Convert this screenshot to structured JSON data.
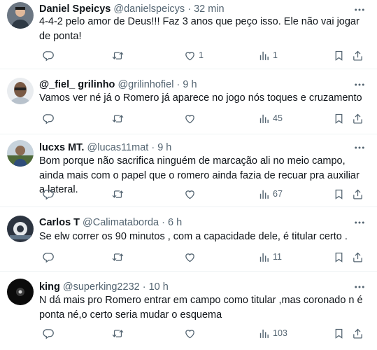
{
  "tweets": [
    {
      "name": "Daniel Speicys",
      "handle": "@danielspeicys",
      "separator": "·",
      "time": "32 min",
      "text": "4-4-2 pelo amor de Deus!!! Faz 3 anos que peço isso. Ele não vai jogar de ponta!",
      "replies": "",
      "retweets": "",
      "likes": "1",
      "views": "1"
    },
    {
      "name": "@_fiel_ grilinho",
      "handle": "@grilinhofiel",
      "separator": "·",
      "time": "9 h",
      "text": "Vamos ver né já o Romero já aparece no jogo nós toques e cruzamento",
      "replies": "",
      "retweets": "",
      "likes": "",
      "views": "45"
    },
    {
      "name": "lucxs MT.",
      "handle": "@lucas11mat",
      "separator": "·",
      "time": "9 h",
      "text": "Bom porque não sacrifica ninguém de marcação ali no meio campo, ainda mais com o papel que o romero ainda fazia de recuar pra auxiliar a lateral.",
      "replies": "",
      "retweets": "",
      "likes": "",
      "views": "67"
    },
    {
      "name": "Carlos T",
      "handle": "@Calimataborda",
      "separator": "·",
      "time": "6 h",
      "text": "Se elw correr os 90 minutos , com a capacidade dele, é titular  certo .",
      "replies": "",
      "retweets": "",
      "likes": "",
      "views": "11"
    },
    {
      "name": "king",
      "handle": "@superking2232",
      "separator": "·",
      "time": "10 h",
      "text": "N dá mais pro Romero entrar em campo como titular ,mas coronado n é ponta né,o certo seria mudar o esquema",
      "replies": "",
      "retweets": "",
      "likes": "",
      "views": "103"
    }
  ],
  "icons": {
    "avatar_colors": [
      "#4a4f55",
      "#c9b8a6",
      "#3d4b6b",
      "#2c3440",
      "#111111"
    ],
    "action_icons": [
      "reply-icon",
      "retweet-icon",
      "like-icon",
      "views-icon",
      "bookmark-icon",
      "share-icon",
      "more-icon"
    ]
  }
}
